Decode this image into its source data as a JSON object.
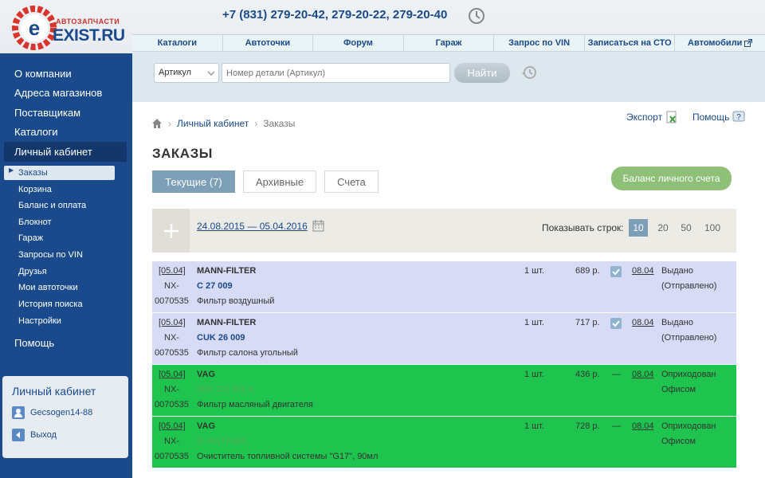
{
  "header": {
    "logo_small": "АВТОЗАПЧАСТИ",
    "logo_big": "EXIST.RU",
    "phones": "+7 (831) 279-20-42, 279-20-22, 279-20-40",
    "nav": [
      "Каталоги",
      "Автоточки",
      "Форум",
      "Гараж",
      "Запрос по VIN",
      "Записаться на СТО",
      "Автомобили"
    ]
  },
  "search": {
    "type": "Артикул",
    "placeholder": "Номер детали (Артикул)",
    "button": "Найти"
  },
  "sidebar": {
    "main": [
      "О компании",
      "Адреса магазинов",
      "Поставщикам",
      "Каталоги",
      "Личный кабинет"
    ],
    "sub": [
      "Заказы",
      "Корзина",
      "Баланс и оплата",
      "Блокнот",
      "Гараж",
      "Запросы по VIN",
      "Друзья",
      "Мои автоточки",
      "История поиска",
      "Настройки"
    ],
    "help": "Помощь",
    "cabinet": {
      "title": "Личный кабинет",
      "user": "Gecsogen14-88",
      "logout": "Выход"
    }
  },
  "breadcrumb": {
    "cabinet": "Личный кабинет",
    "current": "Заказы"
  },
  "actions": {
    "export": "Экспорт",
    "help": "Помощь"
  },
  "page_title": "ЗАКАЗЫ",
  "tabs": [
    "Текущие (7)",
    "Архивные",
    "Счета"
  ],
  "balance_button": "Баланс личного счета",
  "filter": {
    "dates": "24.08.2015 — 05.04.2016",
    "rows_label": "Показывать строк:",
    "rows_options": [
      "10",
      "20",
      "50",
      "100"
    ]
  },
  "orders": [
    {
      "date": "[05.04]",
      "nx1": "NX-",
      "nx2": "0070535",
      "brand": "MANN-FILTER",
      "code": "C 27 009",
      "desc": "Фильтр воздушный",
      "qty": "1 шт.",
      "price": "689 р.",
      "delivery": "08.04",
      "status1": "Выдано",
      "status2": "(Отправлено)"
    },
    {
      "date": "[05.04]",
      "nx1": "NX-",
      "nx2": "0070535",
      "brand": "MANN-FILTER",
      "code": "CUK 26 009",
      "desc": "Фильтр салона угольный",
      "qty": "1 шт.",
      "price": "717 р.",
      "delivery": "08.04",
      "status1": "Выдано",
      "status2": "(Отправлено)"
    },
    {
      "date": "[05.04]",
      "nx1": "NX-",
      "nx2": "0070535",
      "brand": "VAG",
      "code": "06D 115 562 A",
      "desc": "Фильтр масляный двигателя",
      "qty": "1 шт.",
      "price": "436 р.",
      "dash": "—",
      "delivery": "08.04",
      "status1": "Оприходован",
      "status2": "Офисом"
    },
    {
      "date": "[05.04]",
      "nx1": "NX-",
      "nx2": "0070535",
      "brand": "VAG",
      "code": "G 001770A2",
      "desc": "Очиститель топливной системы \"G17\", 90мл",
      "qty": "1 шт.",
      "price": "728 р.",
      "dash": "—",
      "delivery": "08.04",
      "status1": "Оприходован",
      "status2": "Офисом"
    }
  ],
  "colors": {
    "brand_blue": "#1a4a8c",
    "green_row": "#1fc44f",
    "blue_row": "#d7dbf6",
    "balance": "#8ec078"
  }
}
